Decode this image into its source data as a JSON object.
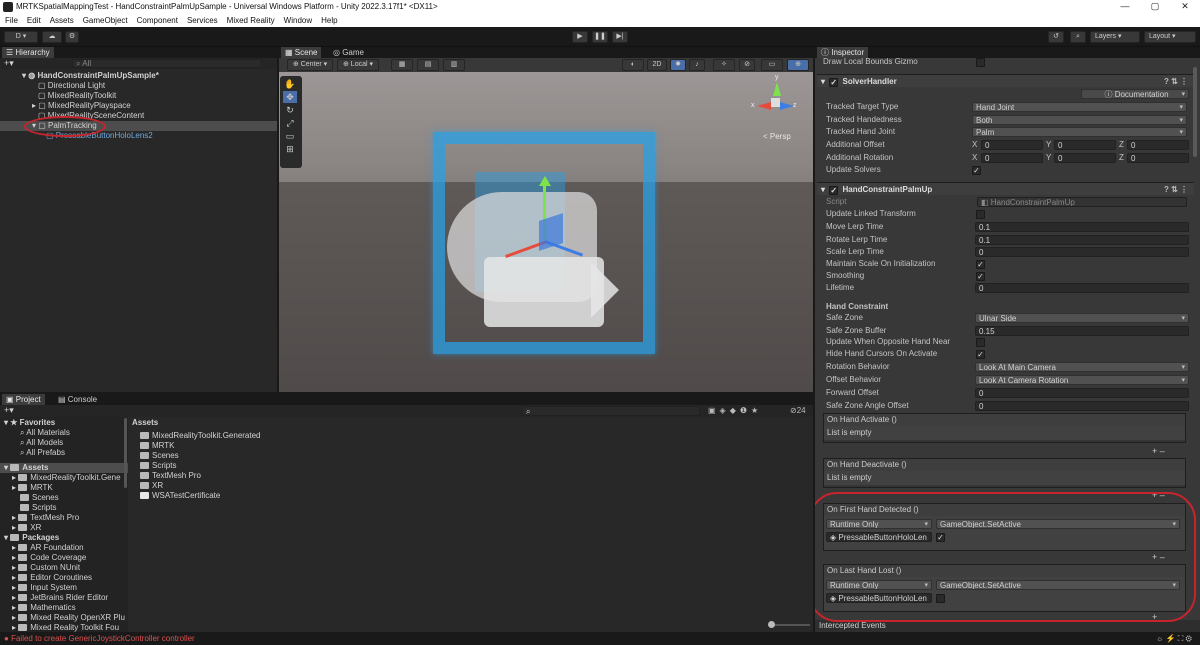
{
  "window": {
    "title": "MRTKSpatialMappingTest - HandConstraintPalmUpSample - Universal Windows Platform - Unity 2022.3.17f1* <DX11>",
    "min": "—",
    "max": "▢",
    "close": "✕"
  },
  "menu": [
    "File",
    "Edit",
    "Assets",
    "GameObject",
    "Component",
    "Services",
    "Mixed Reality",
    "Window",
    "Help"
  ],
  "toolbar": {
    "account": "D",
    "layers": "Layers",
    "layout": "Layout"
  },
  "hierarchy": {
    "tab": "Hierarchy",
    "search_placeholder": "All",
    "scene": "HandConstraintPalmUpSample*",
    "items": [
      "Directional Light",
      "MixedRealityToolkit",
      "MixedRealityPlayspace",
      "MixedRealitySceneContent",
      "PalmTracking",
      "PressableButtonHoloLens2"
    ]
  },
  "scene": {
    "tabs": [
      "Scene",
      "Game"
    ],
    "pivot": "Center",
    "space": "Local",
    "mode2d": "2D",
    "persp": "< Persp",
    "gizmo": {
      "x": "x",
      "y": "y",
      "z": "z"
    }
  },
  "project": {
    "tabs": [
      "Project",
      "Console"
    ],
    "favorites_label": "Favorites",
    "favorites": [
      "All Materials",
      "All Models",
      "All Prefabs"
    ],
    "assets_label": "Assets",
    "assets_tree": [
      "MixedRealityToolkit.Gene",
      "MRTK",
      "Scenes",
      "Scripts",
      "TextMesh Pro",
      "XR"
    ],
    "packages_label": "Packages",
    "packages": [
      "AR Foundation",
      "Code Coverage",
      "Custom NUnit",
      "Editor Coroutines",
      "Input System",
      "JetBrains Rider Editor",
      "Mathematics",
      "Mixed Reality OpenXR Plu",
      "Mixed Reality Toolkit Fou"
    ],
    "breadcrumb": "Assets",
    "contents": [
      "MixedRealityToolkit.Generated",
      "MRTK",
      "Scenes",
      "Scripts",
      "TextMesh Pro",
      "XR",
      "WSATestCertificate"
    ],
    "hidden_count": "24"
  },
  "inspector": {
    "tab": "Inspector",
    "draw_bounds": "Draw Local Bounds Gizmo",
    "solver": {
      "name": "SolverHandler",
      "documentation": "Documentation",
      "rows": [
        {
          "label": "Tracked Target Type",
          "value": "Hand Joint"
        },
        {
          "label": "Tracked Handedness",
          "value": "Both"
        },
        {
          "label": "Tracked Hand Joint",
          "value": "Palm"
        }
      ],
      "additional_offset": "Additional Offset",
      "additional_rotation": "Additional Rotation",
      "xyz": {
        "x": "X",
        "y": "Y",
        "z": "Z",
        "zero": "0"
      },
      "update_solvers": "Update Solvers"
    },
    "palmup": {
      "name": "HandConstraintPalmUp",
      "script_label": "Script",
      "script_value": "HandConstraintPalmUp",
      "update_linked": "Update Linked Transform",
      "move_lerp": {
        "label": "Move Lerp Time",
        "value": "0.1"
      },
      "rotate_lerp": {
        "label": "Rotate Lerp Time",
        "value": "0.1"
      },
      "scale_lerp": {
        "label": "Scale Lerp Time",
        "value": "0"
      },
      "maintain_scale": "Maintain Scale On Initialization",
      "smoothing": "Smoothing",
      "lifetime": {
        "label": "Lifetime",
        "value": "0"
      },
      "hand_constraint": "Hand Constraint",
      "safe_zone": {
        "label": "Safe Zone",
        "value": "Ulnar Side"
      },
      "safe_zone_buffer": {
        "label": "Safe Zone Buffer",
        "value": "0.15"
      },
      "update_opposite": "Update When Opposite Hand Near",
      "hide_cursors": "Hide Hand Cursors On Activate",
      "rotation_behavior": {
        "label": "Rotation Behavior",
        "value": "Look At Main Camera"
      },
      "offset_behavior": {
        "label": "Offset Behavior",
        "value": "Look At Camera Rotation"
      },
      "forward_offset": {
        "label": "Forward Offset",
        "value": "0"
      },
      "safe_zone_angle": {
        "label": "Safe Zone Angle Offset",
        "value": "0"
      },
      "events": {
        "on_activate": "On Hand Activate ()",
        "on_deactivate": "On Hand Deactivate ()",
        "list_empty": "List is empty",
        "on_first": "On First Hand Detected ()",
        "on_last": "On Last Hand Lost ()",
        "runtime": "Runtime Only",
        "function": "GameObject.SetActive",
        "target": "PressableButtonHoloLen"
      }
    },
    "intercepted": "Intercepted Events"
  },
  "status": {
    "error": "Failed to create GenericJoystickController controller"
  }
}
